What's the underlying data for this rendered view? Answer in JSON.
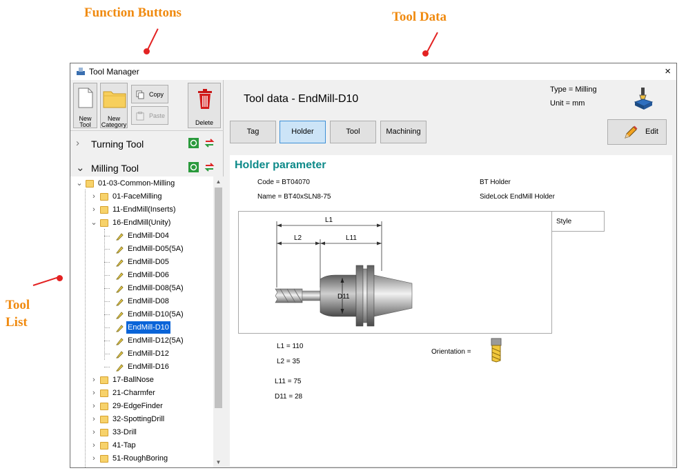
{
  "annotations": {
    "function_buttons": "Function Buttons",
    "tool_data": "Tool Data",
    "tool_list_line1": "Tool",
    "tool_list_line2": "List"
  },
  "window": {
    "title": "Tool Manager",
    "close_glyph": "×"
  },
  "toolbar": {
    "new_tool": [
      "New",
      "Tool"
    ],
    "new_category": [
      "New",
      "Category"
    ],
    "copy": "Copy",
    "paste": "Paste",
    "delete": "Delete"
  },
  "sections": [
    {
      "name": "Turning Tool",
      "expanded": false
    },
    {
      "name": "Milling Tool",
      "expanded": true
    }
  ],
  "tree": {
    "root": "01-03-Common-Milling",
    "groups_before": [
      "01-FaceMilling",
      "11-EndMill(Inserts)"
    ],
    "open_group": "16-EndMill(Unity)",
    "tools": [
      "EndMill-D04",
      "EndMill-D05(5A)",
      "EndMill-D05",
      "EndMill-D06",
      "EndMill-D08(5A)",
      "EndMill-D08",
      "EndMill-D10(5A)",
      "EndMill-D10",
      "EndMill-D12(5A)",
      "EndMill-D12",
      "EndMill-D16"
    ],
    "selected": "EndMill-D10",
    "groups_after": [
      "17-BallNose",
      "21-Charmfer",
      "29-EdgeFinder",
      "32-SpottingDrill",
      "33-Drill",
      "41-Tap",
      "51-RoughBoring"
    ]
  },
  "header": {
    "title": "Tool data - EndMill-D10",
    "type": "Type = Milling",
    "unit": "Unit = mm"
  },
  "tabs": [
    "Tag",
    "Holder",
    "Tool",
    "Machining"
  ],
  "active_tab": "Holder",
  "edit_label": "Edit",
  "holder": {
    "title": "Holder parameter",
    "code": "Code = BT04070",
    "name": "Name = BT40xSLN8-75",
    "holder_type": "BT Holder",
    "holder_desc": "SideLock EndMill Holder",
    "style_label": "Style",
    "diagram_labels": {
      "l1": "L1",
      "l2": "L2",
      "l11": "L11",
      "d11": "D11"
    },
    "params": {
      "l1": "L1 = 110",
      "l2": "L2 = 35",
      "l11": "L11 = 75",
      "d11": "D11 = 28"
    },
    "orientation_label": "Orientation ="
  },
  "colors": {
    "accent_teal": "#0d8a89",
    "selection": "#0a64d8",
    "annotation": "#f08a0f",
    "annotation_mark": "#e32222",
    "tab_active": "#cce4f7"
  },
  "icons": {
    "app": "tool-manager-icon",
    "delete": "trash-icon",
    "recycle": "recycle-icon",
    "exchange": "exchange-icon",
    "machine": "milling-machine-icon",
    "edit": "pencil-icon",
    "tool_leaf": "endmill-icon",
    "orientation": "endmill-orientation-icon"
  }
}
